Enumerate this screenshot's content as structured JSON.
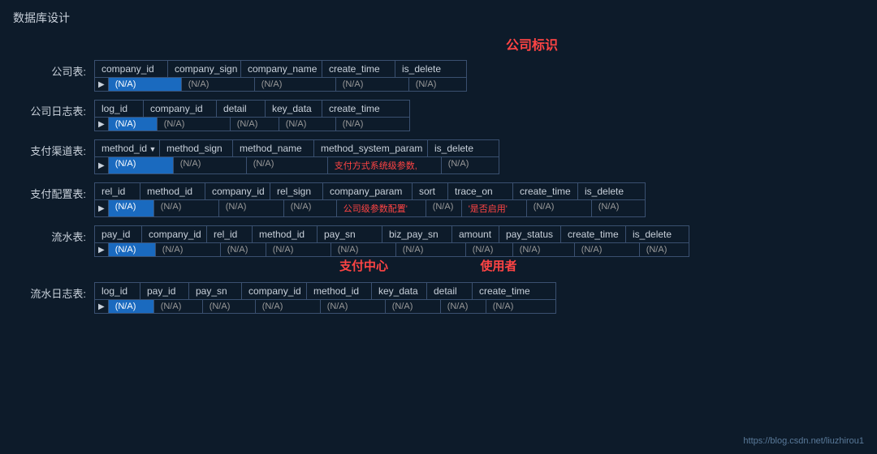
{
  "page": {
    "title": "数据库设计",
    "company_badge": "公司标识",
    "watermark": "https://blog.csdn.net/liuzhirou1"
  },
  "tables": {
    "company": {
      "label": "公司表:",
      "headers": [
        "company_id",
        "company_sign",
        "company_name",
        "create_time",
        "is_delete"
      ],
      "row": [
        "(N/A)",
        "(N/A)",
        "(N/A)",
        "(N/A)",
        "(N/A)"
      ],
      "highlighted": [
        0
      ]
    },
    "company_log": {
      "label": "公司日志表:",
      "headers": [
        "log_id",
        "company_id",
        "detail",
        "key_data",
        "create_time"
      ],
      "row": [
        "(N/A)",
        "(N/A)",
        "(N/A)",
        "(N/A)",
        "(N/A)"
      ],
      "highlighted": [
        0
      ]
    },
    "pay_channel": {
      "label": "支付渠道表:",
      "headers": [
        "method_id",
        "method_sign",
        "method_name",
        "method_system_param",
        "is_delete"
      ],
      "row": [
        "(N/A)",
        "(N/A)",
        "(N/A)",
        "支付方式系统级参数,",
        "(N/A)"
      ],
      "highlighted": [
        0
      ],
      "has_arrow": [
        0
      ],
      "red_text": [
        3
      ]
    },
    "pay_config": {
      "label": "支付配置表:",
      "headers": [
        "rel_id",
        "method_id",
        "company_id",
        "rel_sign",
        "company_param",
        "sort",
        "trace_on",
        "create_time",
        "is_delete"
      ],
      "row": [
        "(N/A)",
        "(N/A)",
        "(N/A)",
        "(N/A)",
        "公司级参数配置'",
        "(N/A)",
        "'是否启用'",
        "(N/A)",
        "(N/A)"
      ],
      "highlighted": [
        0
      ],
      "red_text": [
        4,
        6
      ]
    },
    "transaction": {
      "label": "流水表:",
      "headers": [
        "pay_id",
        "company_id",
        "rel_id",
        "method_id",
        "pay_sn",
        "biz_pay_sn",
        "amount",
        "pay_status",
        "create_time",
        "is_delete"
      ],
      "row": [
        "(N/A)",
        "(N/A)",
        "(N/A)",
        "(N/A)",
        "(N/A)",
        "(N/A)",
        "(N/A)",
        "(N/A)",
        "(N/A)",
        "(N/A)"
      ],
      "highlighted": [
        0
      ],
      "center_labels": [
        {
          "text": "支付中心",
          "col_start": 4
        },
        {
          "text": "使用者",
          "col_start": 6
        }
      ]
    },
    "transaction_log": {
      "label": "流水日志表:",
      "headers": [
        "log_id",
        "pay_id",
        "pay_sn",
        "company_id",
        "method_id",
        "key_data",
        "detail",
        "create_time"
      ],
      "row": [
        "(N/A)",
        "(N/A)",
        "(N/A)",
        "(N/A)",
        "(N/A)",
        "(N/A)",
        "(N/A)",
        "(N/A)"
      ],
      "highlighted": [
        0
      ]
    }
  }
}
